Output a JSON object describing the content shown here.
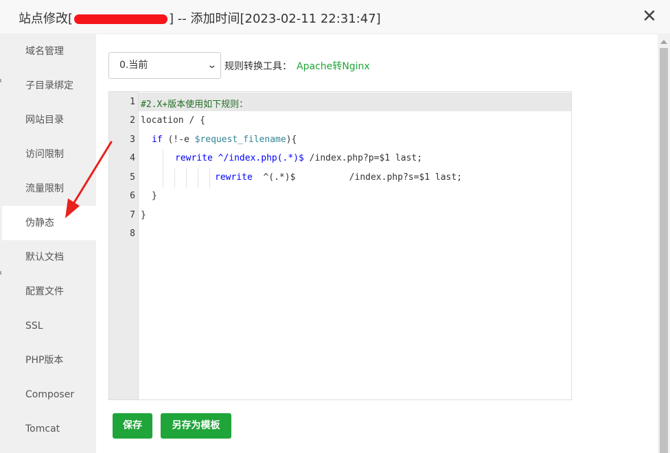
{
  "dialog": {
    "title_prefix": "站点修改[",
    "title_suffix": "] -- 添加时间[2023-02-11 22:31:47]",
    "close_glyph": "✕"
  },
  "sidebar": {
    "items": [
      {
        "label": "域名管理"
      },
      {
        "label": "子目录绑定"
      },
      {
        "label": "网站目录"
      },
      {
        "label": "访问限制"
      },
      {
        "label": "流量限制"
      },
      {
        "label": "伪静态",
        "active": true
      },
      {
        "label": "默认文档"
      },
      {
        "label": "配置文件"
      },
      {
        "label": "SSL"
      },
      {
        "label": "PHP版本"
      },
      {
        "label": "Composer"
      },
      {
        "label": "Tomcat"
      }
    ]
  },
  "rewrite": {
    "selected_option": "0.当前",
    "tool_label": "规则转换工具：",
    "tool_link": "Apache转Nginx"
  },
  "editor": {
    "line_numbers": [
      "1",
      "2",
      "3",
      "4",
      "5",
      "6",
      "7",
      "8"
    ],
    "lines": {
      "l1": "#2.X+版本使用如下规则：",
      "l2": "location / {",
      "l3_kw": "if",
      "l3_a": " (!-e ",
      "l3_var": "$request_filename",
      "l3_b": "){",
      "l4_fn": "rewrite",
      "l4_re": " ^/index.php(.*)$",
      "l4_rest": " /index.php?p=$1 last;",
      "l5_fn": "rewrite",
      "l5_rest": "  ^(.*)$          /index.php?s=$1 last;",
      "l6": "}",
      "l7": "}"
    }
  },
  "buttons": {
    "save": "保存",
    "save_template": "另存为模板"
  },
  "annotation": {
    "arrow_color": "#e8221c"
  }
}
